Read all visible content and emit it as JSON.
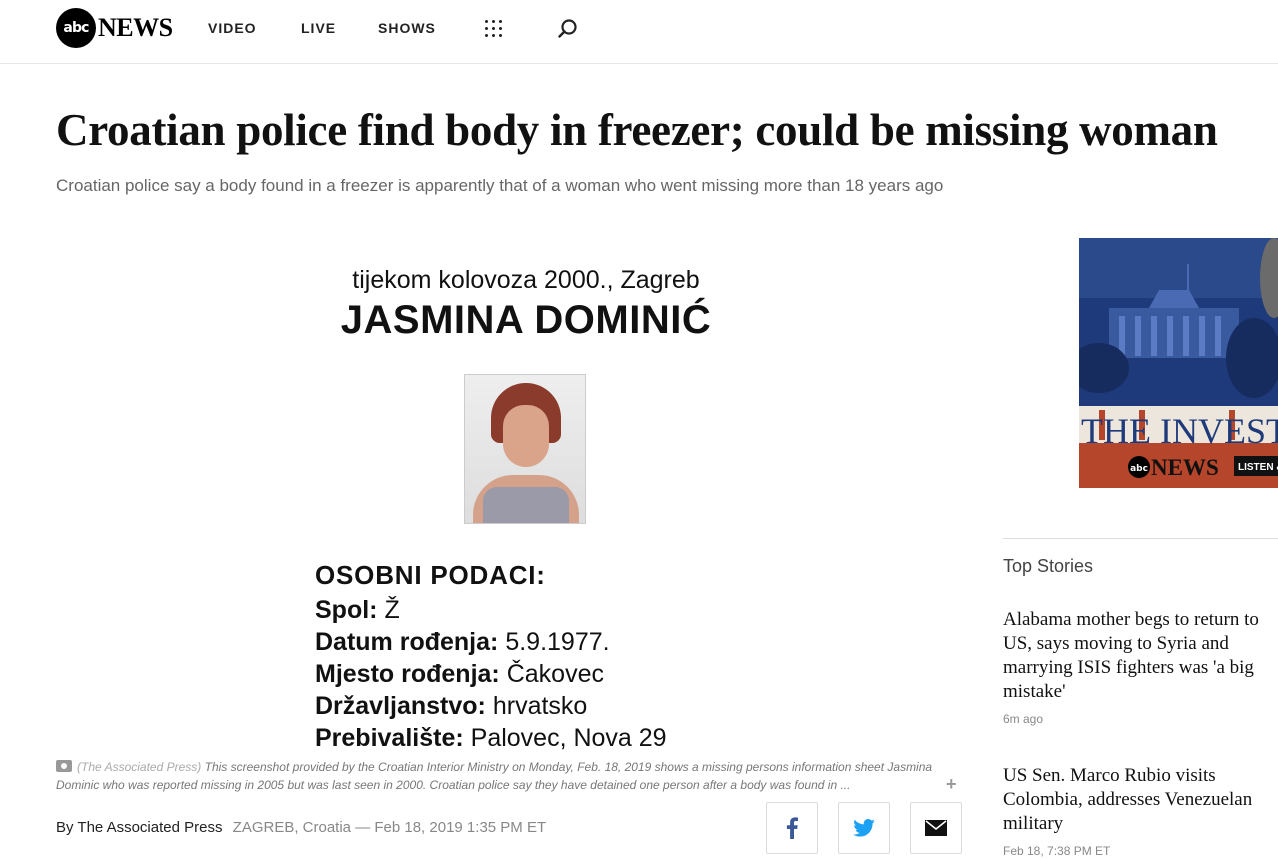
{
  "header": {
    "logo_mark": "abc",
    "logo_text": "NEWS",
    "nav": [
      "VIDEO",
      "LIVE",
      "SHOWS"
    ]
  },
  "article": {
    "headline": "Croatian police find body in freezer; could be missing woman",
    "subhead": "Croatian police say a body found in a freezer is apparently that of a woman who went missing more than 18 years ago",
    "image": {
      "date_line": "tijekom kolovoza 2000., Zagreb",
      "name": "JASMINA DOMINIĆ",
      "section": "OSOBNI PODACI:",
      "rows": [
        {
          "label": "Spol:",
          "value": "Ž"
        },
        {
          "label": "Datum rođenja:",
          "value": "5.9.1977."
        },
        {
          "label": "Mjesto rođenja:",
          "value": "Čakovec"
        },
        {
          "label": "Državljanstvo:",
          "value": "hrvatsko"
        },
        {
          "label": "Prebivalište:",
          "value": "Palovec, Nova 29"
        }
      ]
    },
    "caption_source": "(The Associated Press)",
    "caption_text": "This screenshot provided by the Croatian Interior Ministry on Monday, Feb. 18, 2019 shows a missing persons information sheet Jasmina Dominic who was reported missing in 2005 but was last seen in 2000. Croatian police say they have detained one person after a body was found in ...",
    "byline": "By The Associated Press",
    "dateline": "ZAGREB, Croatia — Feb 18, 2019 1:35 PM ET"
  },
  "ad": {
    "title": "THE INVESTIGA",
    "brand_mark": "abc",
    "brand_text": "NEWS",
    "cta": "LISTEN &"
  },
  "sidebar": {
    "heading": "Top Stories",
    "stories": [
      {
        "title": "Alabama mother begs to return to US, says moving to Syria and marrying ISIS fighters was 'a big mistake'",
        "time": "6m ago"
      },
      {
        "title": "US Sen. Marco Rubio visits Colombia, addresses Venezuelan military",
        "time": "Feb 18, 7:38 PM ET"
      }
    ]
  },
  "colors": {
    "facebook": "#3b5998",
    "twitter": "#1da1f2",
    "ad_blue": "#1e3a7a",
    "ad_red": "#b5452b"
  },
  "icons": [
    "apps-grid-icon",
    "search-icon",
    "camera-icon",
    "expand-icon",
    "facebook-icon",
    "twitter-icon",
    "email-icon"
  ]
}
